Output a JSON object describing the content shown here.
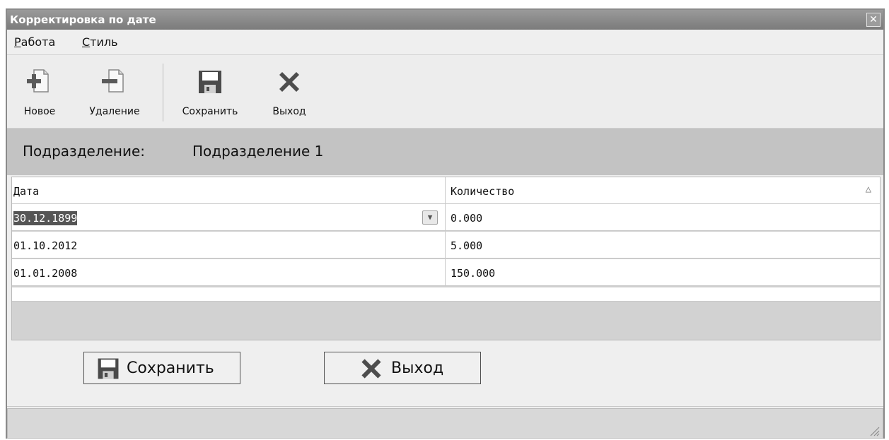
{
  "window": {
    "title": "Корректировка по дате",
    "close_glyph": "✕"
  },
  "menu": [
    {
      "underlined": "Р",
      "rest": "абота"
    },
    {
      "underlined": "С",
      "rest": "тиль"
    }
  ],
  "toolbar": {
    "new_label": "Новое",
    "delete_label": "Удаление",
    "save_label": "Сохранить",
    "exit_label": "Выход"
  },
  "department": {
    "label": "Подразделение:",
    "value": "Подразделение 1"
  },
  "grid": {
    "columns": [
      "Дата",
      "Количество"
    ],
    "sort_indicator": "△",
    "dropdown_glyph": "▼",
    "rows": [
      {
        "date": "30.12.1899",
        "quantity": "0.000"
      },
      {
        "date": "01.10.2012",
        "quantity": "5.000"
      },
      {
        "date": "01.01.2008",
        "quantity": "150.000"
      }
    ]
  },
  "buttons": {
    "save_label": "Сохранить",
    "exit_label": "Выход"
  },
  "icons": {
    "new": "add-document-icon",
    "delete": "remove-document-icon",
    "save": "floppy-disk-icon",
    "exit": "x-cross-icon"
  },
  "colors": {
    "titlebar": "#8a8a8a",
    "department_bar": "#c3c3c3",
    "selection": "#555555"
  }
}
